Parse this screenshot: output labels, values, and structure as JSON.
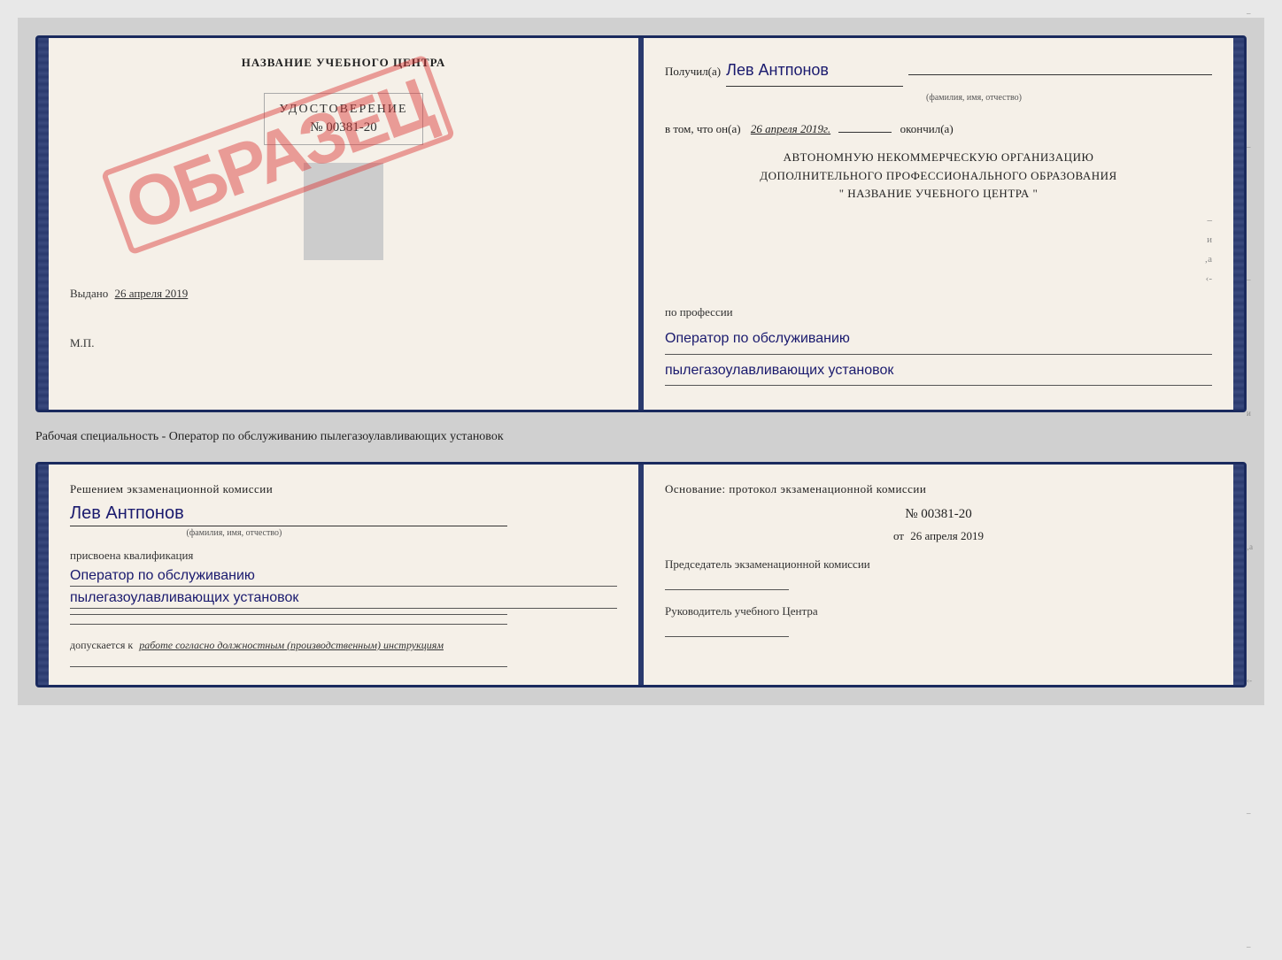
{
  "page": {
    "background": "#d0d0d0"
  },
  "top_book": {
    "left_page": {
      "header": "НАЗВАНИЕ УЧЕБНОГО ЦЕНТРА",
      "document_type": "УДОСТОВЕРЕНИЕ",
      "document_number": "№ 00381-20",
      "stamp_text": "ОБРАЗЕЦ",
      "issued_label": "Выдано",
      "issued_date": "26 апреля 2019",
      "mp_label": "М.П."
    },
    "right_page": {
      "received_prefix": "Получил(а)",
      "received_name": "Лев Антпонов",
      "fio_label": "(фамилия, имя, отчество)",
      "confirmed_prefix": "в том, что он(а)",
      "confirmed_date": "26 апреля 2019г.",
      "confirmed_suffix": "окончил(а)",
      "org_line1": "АВТОНОМНУЮ НЕКОММЕРЧЕСКУЮ ОРГАНИЗАЦИЮ",
      "org_line2": "ДОПОЛНИТЕЛЬНОГО ПРОФЕССИОНАЛЬНОГО ОБРАЗОВАНИЯ",
      "org_name": "\" НАЗВАНИЕ УЧЕБНОГО ЦЕНТРА \"",
      "profession_prefix": "по профессии",
      "profession_line1": "Оператор по обслуживанию",
      "profession_line2": "пылегазоулавливающих установок"
    }
  },
  "divider": {
    "text": "Рабочая специальность - Оператор по обслуживанию пылегазоулавливающих установок"
  },
  "bottom_book": {
    "left_page": {
      "resolution_header": "Решением экзаменационной комиссии",
      "person_name": "Лев Антпонов",
      "fio_label": "(фамилия, имя, отчество)",
      "qualification_prefix": "присвоена квалификация",
      "qualification_line1": "Оператор по обслуживанию",
      "qualification_line2": "пылегазоулавливающих установок",
      "allowed_prefix": "допускается к",
      "allowed_text": "работе согласно должностным (производственным) инструкциям"
    },
    "right_page": {
      "basis_label": "Основание: протокол экзаменационной комиссии",
      "protocol_number": "№  00381-20",
      "protocol_date_prefix": "от",
      "protocol_date": "26 апреля 2019",
      "committee_chair_label": "Председатель экзаменационной комиссии",
      "center_head_label": "Руководитель учебного Центра"
    }
  }
}
